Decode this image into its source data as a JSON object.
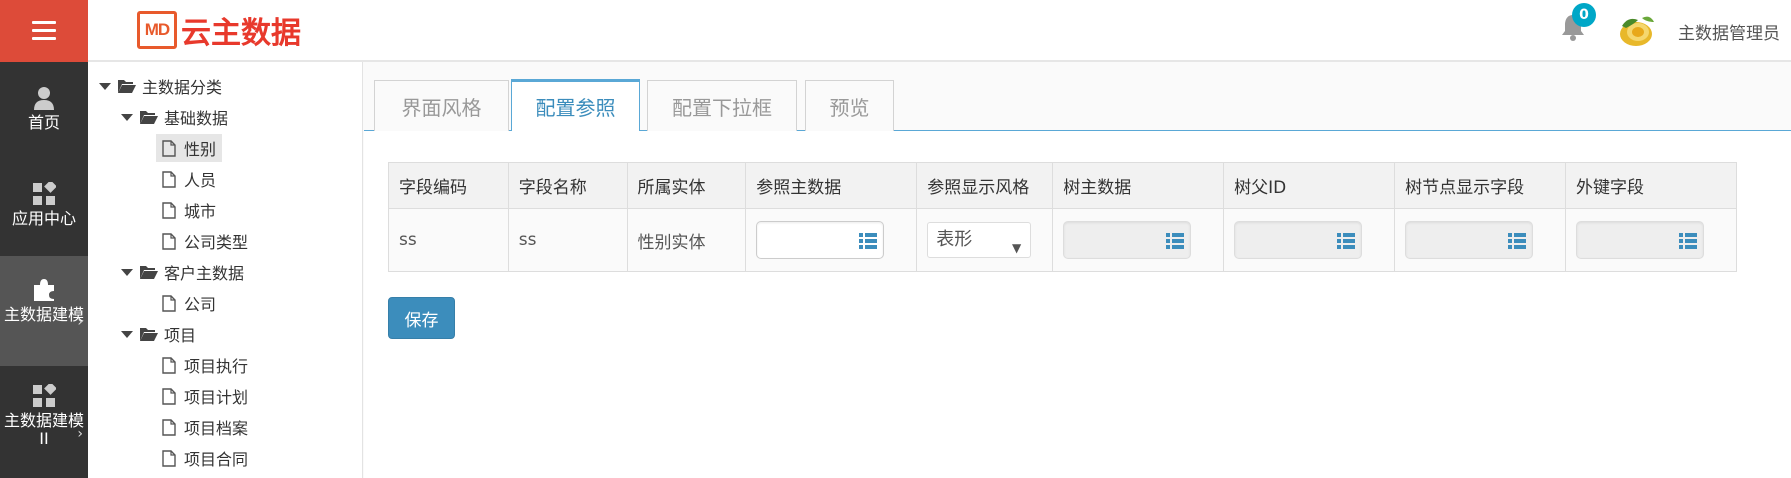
{
  "app": {
    "logo_mark": "MD",
    "logo_text": "云主数据",
    "notifications_count": "0",
    "user_name": "主数据管理员"
  },
  "leftnav": {
    "items": [
      {
        "label": "首页",
        "icon": "person-icon"
      },
      {
        "label": "应用中心",
        "icon": "apps-icon"
      },
      {
        "label": "主数据建模",
        "icon": "puzzle-icon",
        "active": true
      },
      {
        "label": "主数据建模II",
        "icon": "apps-icon"
      }
    ],
    "chevron": "›"
  },
  "tree": {
    "nodes": [
      {
        "label": "主数据分类",
        "type": "folder",
        "level": 0
      },
      {
        "label": "基础数据",
        "type": "folder",
        "level": 1
      },
      {
        "label": "性别",
        "type": "file",
        "level": 2,
        "selected": true
      },
      {
        "label": "人员",
        "type": "file",
        "level": 2
      },
      {
        "label": "城市",
        "type": "file",
        "level": 2
      },
      {
        "label": "公司类型",
        "type": "file",
        "level": 2
      },
      {
        "label": "客户主数据",
        "type": "folder",
        "level": 1
      },
      {
        "label": "公司",
        "type": "file",
        "level": 2
      },
      {
        "label": "项目",
        "type": "folder",
        "level": 1
      },
      {
        "label": "项目执行",
        "type": "file",
        "level": 2
      },
      {
        "label": "项目计划",
        "type": "file",
        "level": 2
      },
      {
        "label": "项目档案",
        "type": "file",
        "level": 2
      },
      {
        "label": "项目合同",
        "type": "file",
        "level": 2
      }
    ]
  },
  "tabs": [
    {
      "label": "界面风格"
    },
    {
      "label": "配置参照",
      "active": true
    },
    {
      "label": "配置下拉框"
    },
    {
      "label": "预览"
    }
  ],
  "table": {
    "headers": [
      "字段编码",
      "字段名称",
      "所属实体",
      "参照主数据",
      "参照显示风格",
      "树主数据",
      "树父ID",
      "树节点显示字段",
      "外键字段"
    ],
    "row": {
      "code": "ss",
      "name": "ss",
      "entity": "性别实体",
      "ref_master_data": "",
      "display_style": "表形",
      "tree_master_data": "",
      "tree_parent_id": "",
      "tree_node_display_field": "",
      "foreign_key_field": ""
    }
  },
  "actions": {
    "save_label": "保存"
  },
  "colors": {
    "menu_bg": "#dd4b39",
    "sidebar_bg": "#333333",
    "accent": "#3c8dbc",
    "badge": "#00a7c7",
    "logo": "#e8392c"
  }
}
